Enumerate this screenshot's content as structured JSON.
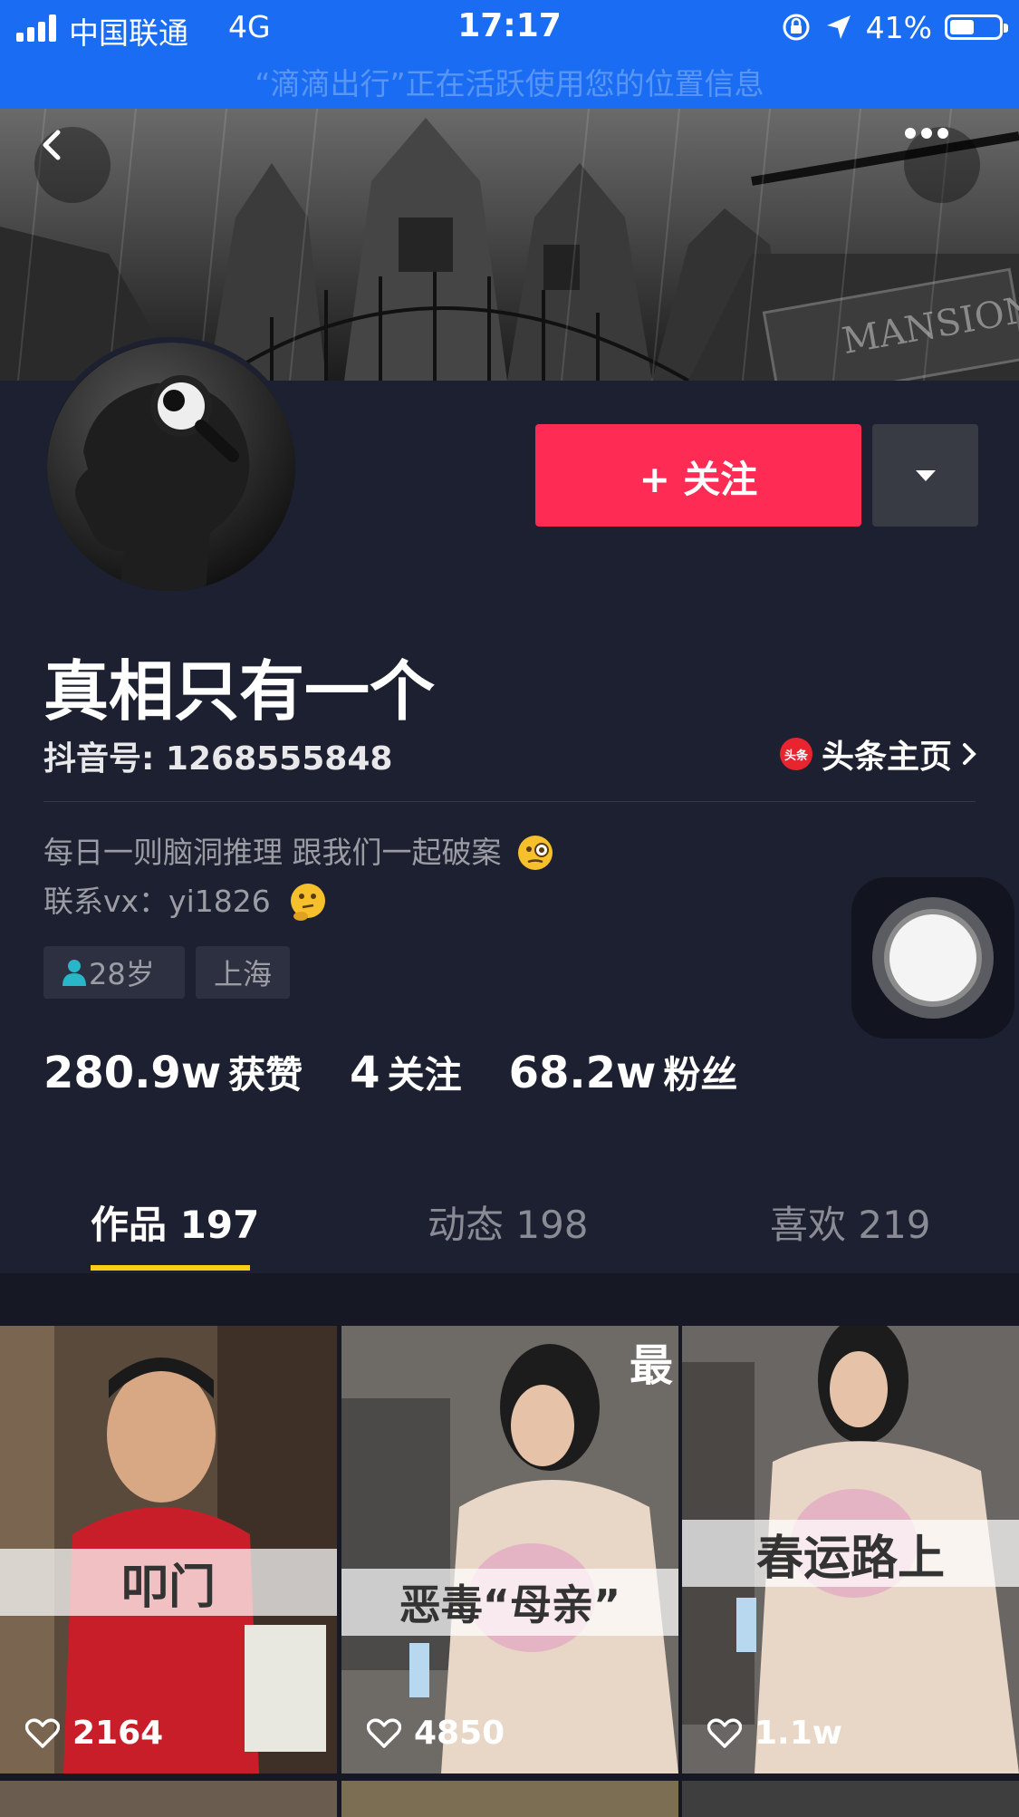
{
  "status_bar": {
    "carrier": "中国联通",
    "network": "4G",
    "time": "17:17",
    "battery": "41%",
    "location_banner": "“滴滴出行”正在活跃使用您的位置信息"
  },
  "profile": {
    "follow_label": "+ 关注",
    "name": "真相只有一个",
    "douyin_id": "抖音号: 1268555848",
    "toutiao_logo": "头条",
    "toutiao_link": "头条主页",
    "bio_line1": "每日一则脑洞推理 跟我们一起破案",
    "bio_line2": "联系vx：yi1826",
    "tag_age": "28岁",
    "tag_city": "上海",
    "stats": [
      {
        "num": "280.9w",
        "label": "获赞"
      },
      {
        "num": "4",
        "label": "关注"
      },
      {
        "num": "68.2w",
        "label": "粉丝"
      }
    ]
  },
  "tabs": [
    {
      "label": "作品 197"
    },
    {
      "label": "动态 198"
    },
    {
      "label": "喜欢 219"
    }
  ],
  "videos": [
    {
      "caption": "叩门",
      "likes": "2164",
      "corner": ""
    },
    {
      "caption": "恶毒“母亲”",
      "likes": "4850",
      "corner": "最"
    },
    {
      "caption": "春运路上",
      "likes": "1.1w",
      "corner": ""
    }
  ],
  "colors": {
    "status_bar": "#1a6df2",
    "follow_button": "#fe2c55",
    "tab_underline": "#face15",
    "page_bg": "#161823"
  }
}
